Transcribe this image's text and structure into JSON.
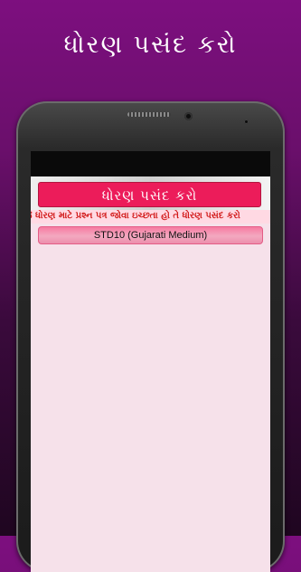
{
  "promo": {
    "title": "ધોરણ પસંદ કરો"
  },
  "app": {
    "header_button": "ધોરણ પસંદ કરો",
    "marquee": "જે ધોરણ માટે પ્રશ્ન પત્ર જોવા ઇચ્છતા હો તે ધોરણ પસંદ કરો",
    "standards": [
      {
        "label": "STD10 (Gujarati Medium)"
      }
    ]
  },
  "colors": {
    "accent": "#ec1c5a",
    "background": "#7d0f7f",
    "screen_bg": "#f6e1ea",
    "marquee_text": "#d21b1b"
  }
}
